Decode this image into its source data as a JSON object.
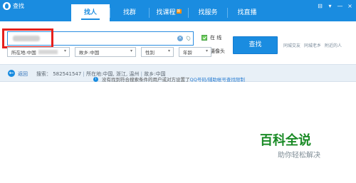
{
  "window": {
    "title": "查找",
    "controls": [
      "⊟",
      "▾",
      "—",
      "×"
    ]
  },
  "tabs": [
    {
      "label": "找人",
      "active": true
    },
    {
      "label": "找群"
    },
    {
      "label": "找课程",
      "badge": "新"
    },
    {
      "label": "找服务"
    },
    {
      "label": "找直播"
    }
  ],
  "search": {
    "value": "",
    "placeholder": "",
    "clear_symbol": "×"
  },
  "options": {
    "online_label": "在 线",
    "camera_label": "摄像头"
  },
  "search_button": {
    "label": "查找"
  },
  "quick_links": [
    "同城交友",
    "同城老乡",
    "附近的人"
  ],
  "filters": {
    "location": "所在地:中国",
    "hometown": "故乡:中国",
    "gender": "性别",
    "age": "年龄"
  },
  "info_bar": {
    "back_label": "返回",
    "search_label": "搜索： 582541547",
    "location_label": "所在地:中国, 浙江, 温州",
    "hometown_label": "故乡:中国"
  },
  "notice": {
    "text": "没有找到符合搜索条件的用户或对方设置了",
    "link": "QQ号码/辅助帐号查找限制",
    "icon_text": "i"
  },
  "watermark": {
    "title": "百科全说",
    "subtitle": "助你轻松解决"
  },
  "colors": {
    "accent": "#1a8ce0",
    "highlight": "#e5201d",
    "watermark": "#1a8b26"
  }
}
